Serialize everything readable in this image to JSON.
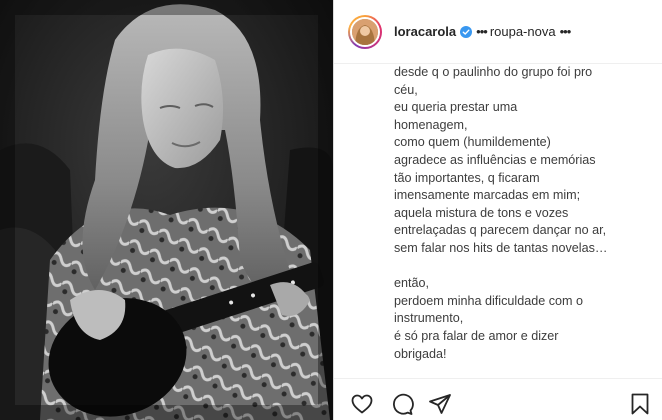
{
  "post": {
    "username": "loracarola",
    "subtitle": "roupa-nova",
    "subtitle_prefix": "•••",
    "subtitle_suffix": "•••",
    "caption": "desde q o paulinho do grupo foi pro\ncéu,\neu queria prestar uma\nhomenagem,\ncomo quem (humildemente)\nagradece as influências e memórias\ntão importantes, q ficaram\nimensamente marcadas em mim;\naquela mistura de tons e vozes\nentrelaçadas q parecem dançar no ar,\nsem falar nos hits de tantas novelas…\n\nentão,\nperdoem minha dificuldade com o\ninstrumento,\né só pra falar de amor e dizer\nobrigada!"
  },
  "icons": {
    "verified": "verified-badge-icon",
    "like": "heart-icon",
    "comment": "comment-bubble-icon",
    "share": "paper-plane-icon",
    "save": "bookmark-icon"
  },
  "colors": {
    "verified": "#3897f0",
    "text": "#262626",
    "border": "#dbdbdb"
  }
}
